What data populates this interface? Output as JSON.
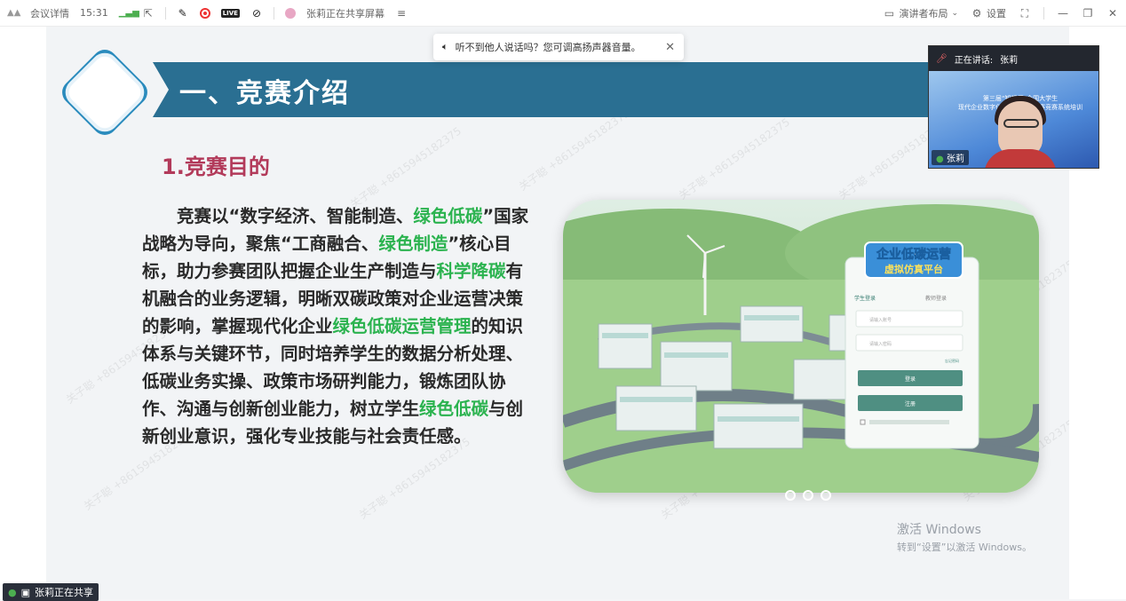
{
  "topbar": {
    "meeting_details": "会议详情",
    "time": "15:31",
    "sharing_status": "张莉正在共享屏幕",
    "sharing_menu_glyph": "≡",
    "presenter_layout": "演讲者布局",
    "settings": "设置"
  },
  "toast": {
    "message": "听不到他人说话吗？您可调高扬声器音量。"
  },
  "slide": {
    "title": "一、竞赛介绍",
    "subtitle": "1.竞赛目的",
    "paragraph_segments": [
      {
        "text": "竞赛以“数字经济、智能制造、",
        "green": false
      },
      {
        "text": "绿色低碳",
        "green": true
      },
      {
        "text": "”国家战略为导向，聚焦“工商融合、",
        "green": false
      },
      {
        "text": "绿色制造",
        "green": true
      },
      {
        "text": "”核心目标，助力参赛团队把握企业生产制造与",
        "green": false
      },
      {
        "text": "科学降碳",
        "green": true
      },
      {
        "text": "有机融合的业务逻辑，明晰双碳政策对企业运营决策的影响，掌握现代化企业",
        "green": false
      },
      {
        "text": "绿色低碳运营管理",
        "green": true
      },
      {
        "text": "的知识体系与关键环节，同时培养学生的数据分析处理、低碳业务实操、政策市场研判能力，锻炼团队协作、沟通与创新创业能力，树立学生",
        "green": false
      },
      {
        "text": "绿色低碳",
        "green": true
      },
      {
        "text": "与创新创业意识，强化专业技能与社会责任感。",
        "green": false
      }
    ],
    "image_logo_text": [
      "企业低碳运营",
      "虚拟仿真平台"
    ],
    "image_login": {
      "tab_student": "学生登录",
      "tab_teacher": "教师登录",
      "placeholder_user": "请输入账号",
      "placeholder_pass": "请输入密码",
      "forgot": "忘记密码",
      "login_button": "登录",
      "register_button": "注册"
    },
    "watermark": "关子聪 +8615945182375",
    "colors": {
      "banner": "#2a6f92",
      "subtitle": "#b23a5a",
      "highlight_green": "#2bb34f"
    }
  },
  "speaker_panel": {
    "label": "正在讲话:",
    "speaker": "张莉",
    "name_tag": "张莉",
    "screen_text": [
      "第三届“知韬杯”全国大学生",
      "现代企业数字化运营实…挑战赛竞赛系统培训"
    ]
  },
  "windows_activation": {
    "line1": "激活 Windows",
    "line2": "转到“设置”以激活 Windows。"
  },
  "share_badge": {
    "text": "张莉正在共享"
  }
}
